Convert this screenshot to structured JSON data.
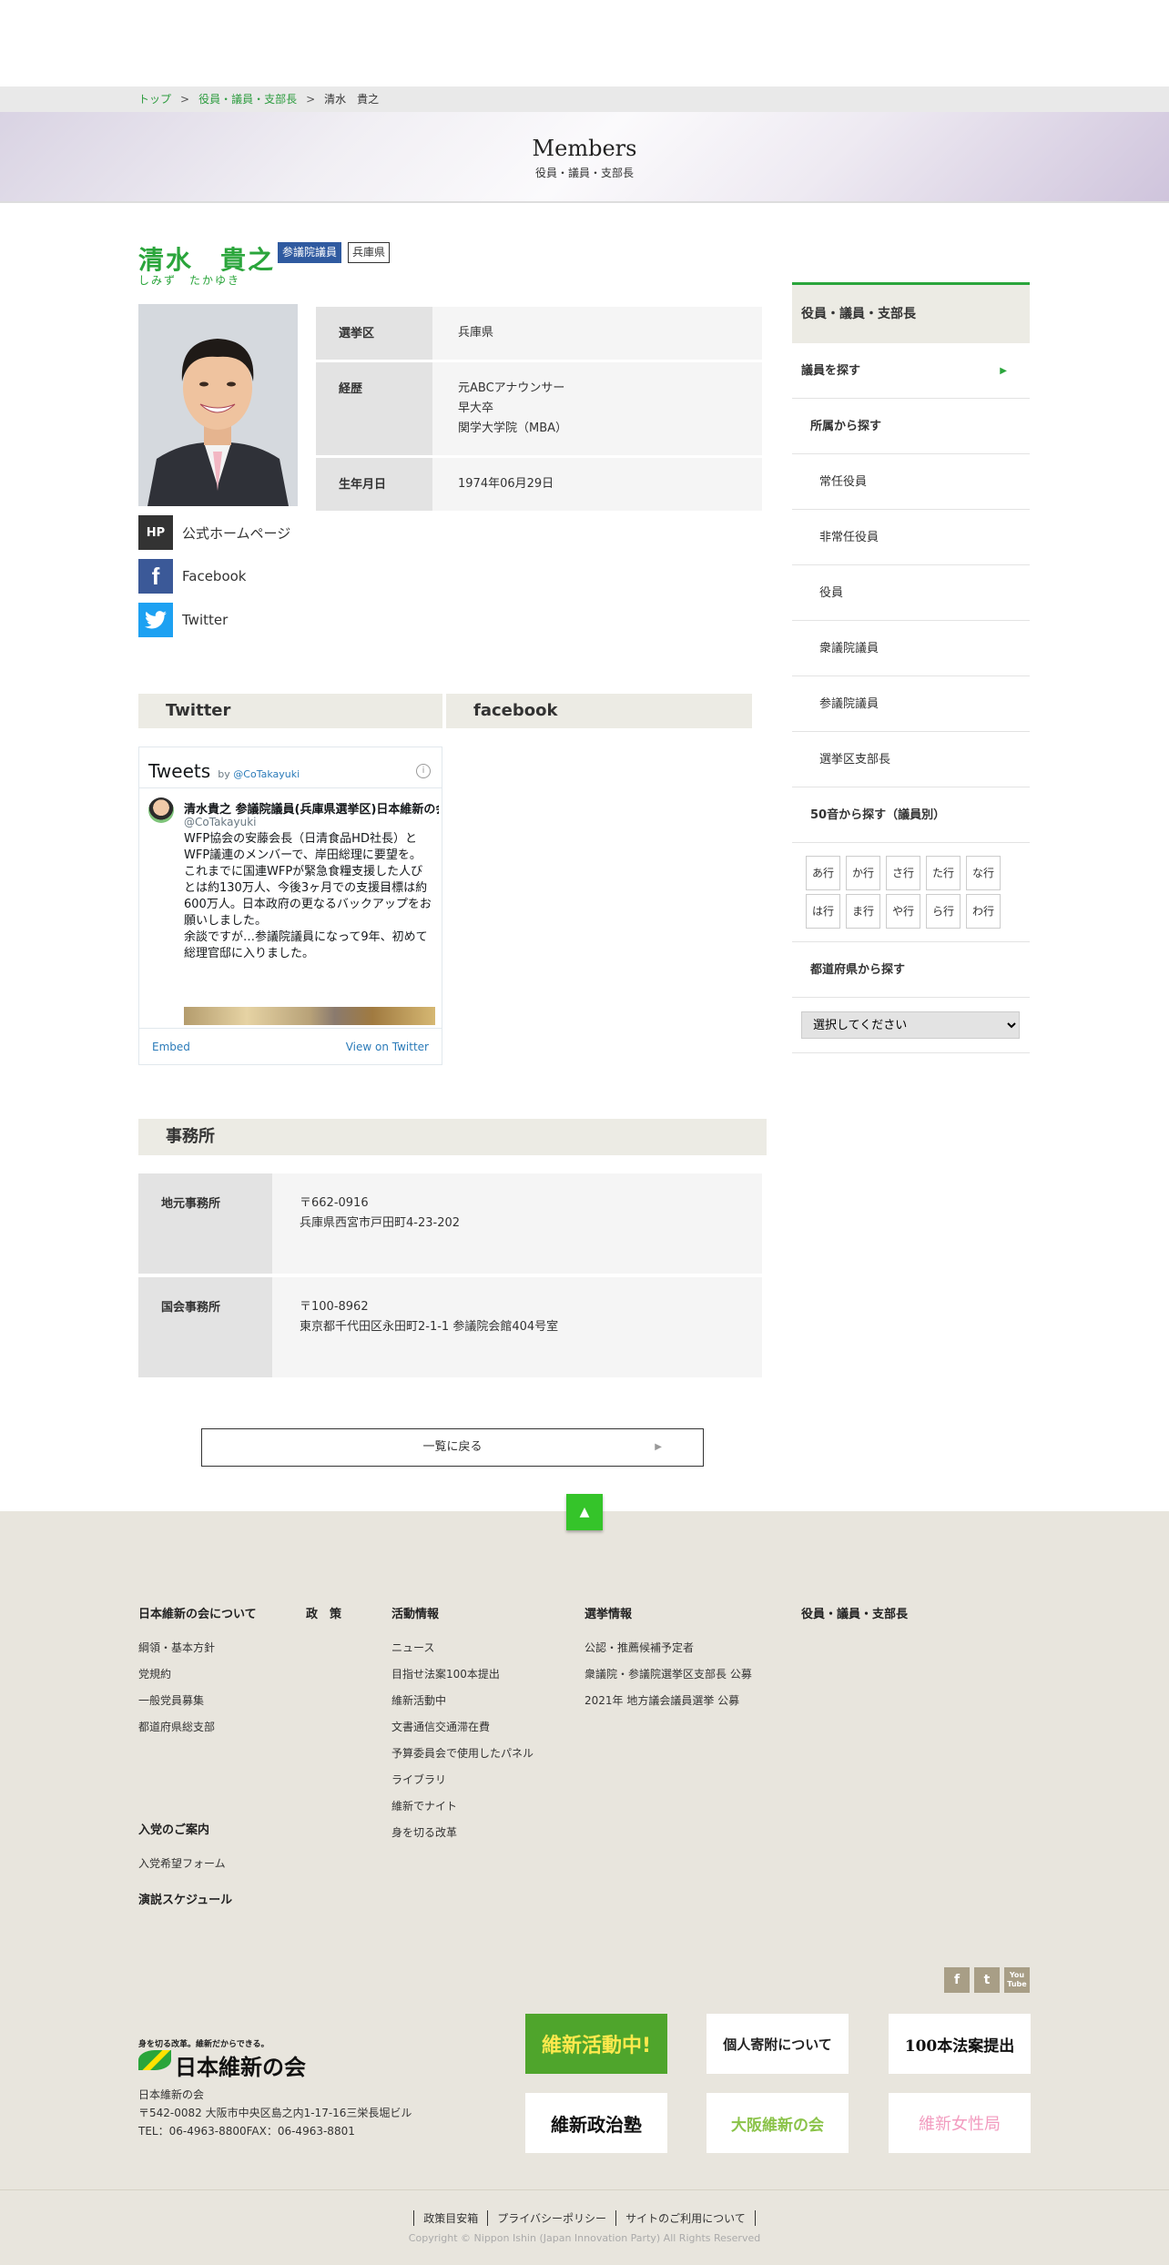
{
  "breadcrumb": {
    "home": "トップ",
    "section": "役員・議員・支部長",
    "current": "清水　貴之",
    "sep": ">"
  },
  "hero": {
    "title": "Members",
    "subtitle": "役員・議員・支部長"
  },
  "member": {
    "name": "清水　貴之",
    "kana": "しみず　たかゆき",
    "badge_house": "参議院議員",
    "badge_pref": "兵庫県",
    "profile": [
      {
        "label": "選挙区",
        "lines": [
          "兵庫県"
        ]
      },
      {
        "label": "経歴",
        "lines": [
          "元ABCアナウンサー",
          "早大卒",
          "関学大学院（MBA）"
        ]
      },
      {
        "label": "生年月日",
        "lines": [
          "1974年06月29日"
        ]
      }
    ],
    "links": [
      {
        "icon_text": "HP",
        "label": "公式ホームページ"
      },
      {
        "icon_text": "f",
        "label": "Facebook"
      },
      {
        "icon_text": "🐦",
        "label": "Twitter"
      }
    ]
  },
  "tabs": {
    "twitter": "Twitter",
    "facebook": "facebook"
  },
  "tweet": {
    "header": "Tweets",
    "by": "by",
    "by_handle": "@CoTakayuki",
    "info": "i",
    "user": "清水貴之 参議院議員(兵庫県選挙区)日本維新の会",
    "handle": "@CoTakayuki",
    "text": "WFP協会の安藤会長（日清食品HD社長）とWFP議連のメンバーで、岸田総理に要望を。\nこれまでに国連WFPが緊急食糧支援した人びとは約130万人、今後3ヶ月での支援目標は約600万人。日本政府の更なるバックアップをお願いしました。\n余談ですが…参議院議員になって9年、初めて総理官邸に入りました。",
    "embed": "Embed",
    "view": "View on Twitter"
  },
  "office": {
    "heading": "事務所",
    "rows": [
      {
        "label": "地元事務所",
        "zip": "〒662-0916",
        "addr": "兵庫県西宮市戸田町4-23-202"
      },
      {
        "label": "国会事務所",
        "zip": "〒100-8962",
        "addr": "東京都千代田区永田町2-1-1 参議院会館404号室"
      }
    ]
  },
  "back_button": {
    "label": "一覧に戻る",
    "arrow": "▶"
  },
  "to_top": "▲",
  "sidebar": {
    "title": "役員・議員・支部長",
    "search": "議員を探す",
    "search_arrow": "▶",
    "by_affiliation": "所属から探す",
    "affiliations": [
      "常任役員",
      "非常任役員",
      "役員",
      "衆議院議員",
      "参議院議員",
      "選挙区支部長"
    ],
    "by_kana": "50音から探す（議員別）",
    "kana_row1": [
      "あ行",
      "か行",
      "さ行",
      "た行",
      "な行"
    ],
    "kana_row2": [
      "は行",
      "ま行",
      "や行",
      "ら行",
      "わ行"
    ],
    "by_pref": "都道府県から探す",
    "pref_select": "選択してください"
  },
  "footer": {
    "col1": {
      "title": "日本維新の会について",
      "items": [
        "綱領・基本方針",
        "党規約",
        "一般党員募集",
        "都道府県総支部"
      ]
    },
    "col2": {
      "title": "政　策",
      "items": []
    },
    "col3": {
      "title": "活動情報",
      "items": [
        "ニュース",
        "目指せ法案100本提出",
        "維新活動中",
        "文書通信交通滞在費",
        "予算委員会で使用したパネル",
        "ライブラリ",
        "維新でナイト",
        "身を切る改革"
      ]
    },
    "col4": {
      "title": "選挙情報",
      "items": [
        "公認・推薦候補予定者",
        "衆議院・参議院選挙区支部長 公募",
        "2021年 地方議会議員選挙 公募"
      ]
    },
    "col5": {
      "title": "役員・議員・支部長",
      "items": []
    },
    "col6": {
      "title": "入党のご案内",
      "items": [
        "入党希望フォーム"
      ]
    },
    "col7": {
      "title": "演説スケジュール"
    },
    "social": [
      "f",
      "t",
      "You\nTube"
    ],
    "logo_tagline": "身を切る改革。維新だからできる。",
    "logo_name": "日本維新の会",
    "address": [
      "日本維新の会",
      "〒542-0082 大阪市中央区島之内1-17-16三栄長堀ビル",
      "TEL：06-4963-8800FAX：06-4963-8801"
    ],
    "banners": [
      "維新活動中!",
      "個人寄附について",
      "100本法案提出",
      "維新政治塾",
      "大阪維新の会",
      "維新女性局"
    ],
    "bottom_links": [
      "政策目安箱",
      "プライバシーポリシー",
      "サイトのご利用について"
    ],
    "copyright": "Copyright © Nippon Ishin (Japan Innovation Party) All Rights Reserved"
  }
}
